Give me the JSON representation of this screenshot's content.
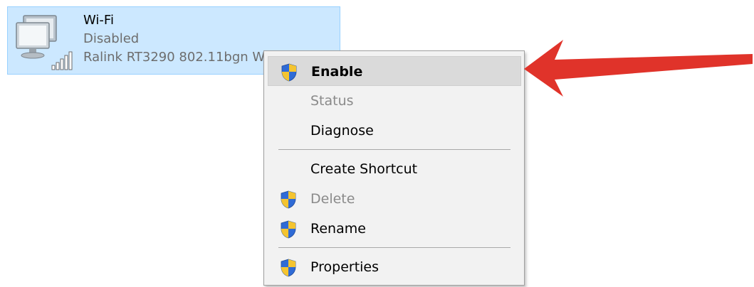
{
  "adapter": {
    "name": "Wi-Fi",
    "status": "Disabled",
    "device": "Ralink RT3290 802.11bgn W"
  },
  "context_menu": {
    "items": [
      {
        "label": "Enable",
        "icon": "uac-shield-icon",
        "bold": true,
        "disabled": false,
        "highlighted": true
      },
      {
        "label": "Status",
        "icon": "",
        "bold": false,
        "disabled": true,
        "highlighted": false
      },
      {
        "label": "Diagnose",
        "icon": "",
        "bold": false,
        "disabled": false,
        "highlighted": false
      },
      {
        "label": "Create Shortcut",
        "icon": "",
        "bold": false,
        "disabled": false,
        "highlighted": false
      },
      {
        "label": "Delete",
        "icon": "uac-shield-icon",
        "bold": false,
        "disabled": true,
        "highlighted": false
      },
      {
        "label": "Rename",
        "icon": "uac-shield-icon",
        "bold": false,
        "disabled": false,
        "highlighted": false
      },
      {
        "label": "Properties",
        "icon": "uac-shield-icon",
        "bold": false,
        "disabled": false,
        "highlighted": false
      }
    ]
  },
  "colors": {
    "selection_background": "#cce8ff",
    "menu_background": "#f2f2f2",
    "menu_highlight": "#dadada",
    "arrow": "#e0332a",
    "disabled_text": "#8a8a8a"
  }
}
